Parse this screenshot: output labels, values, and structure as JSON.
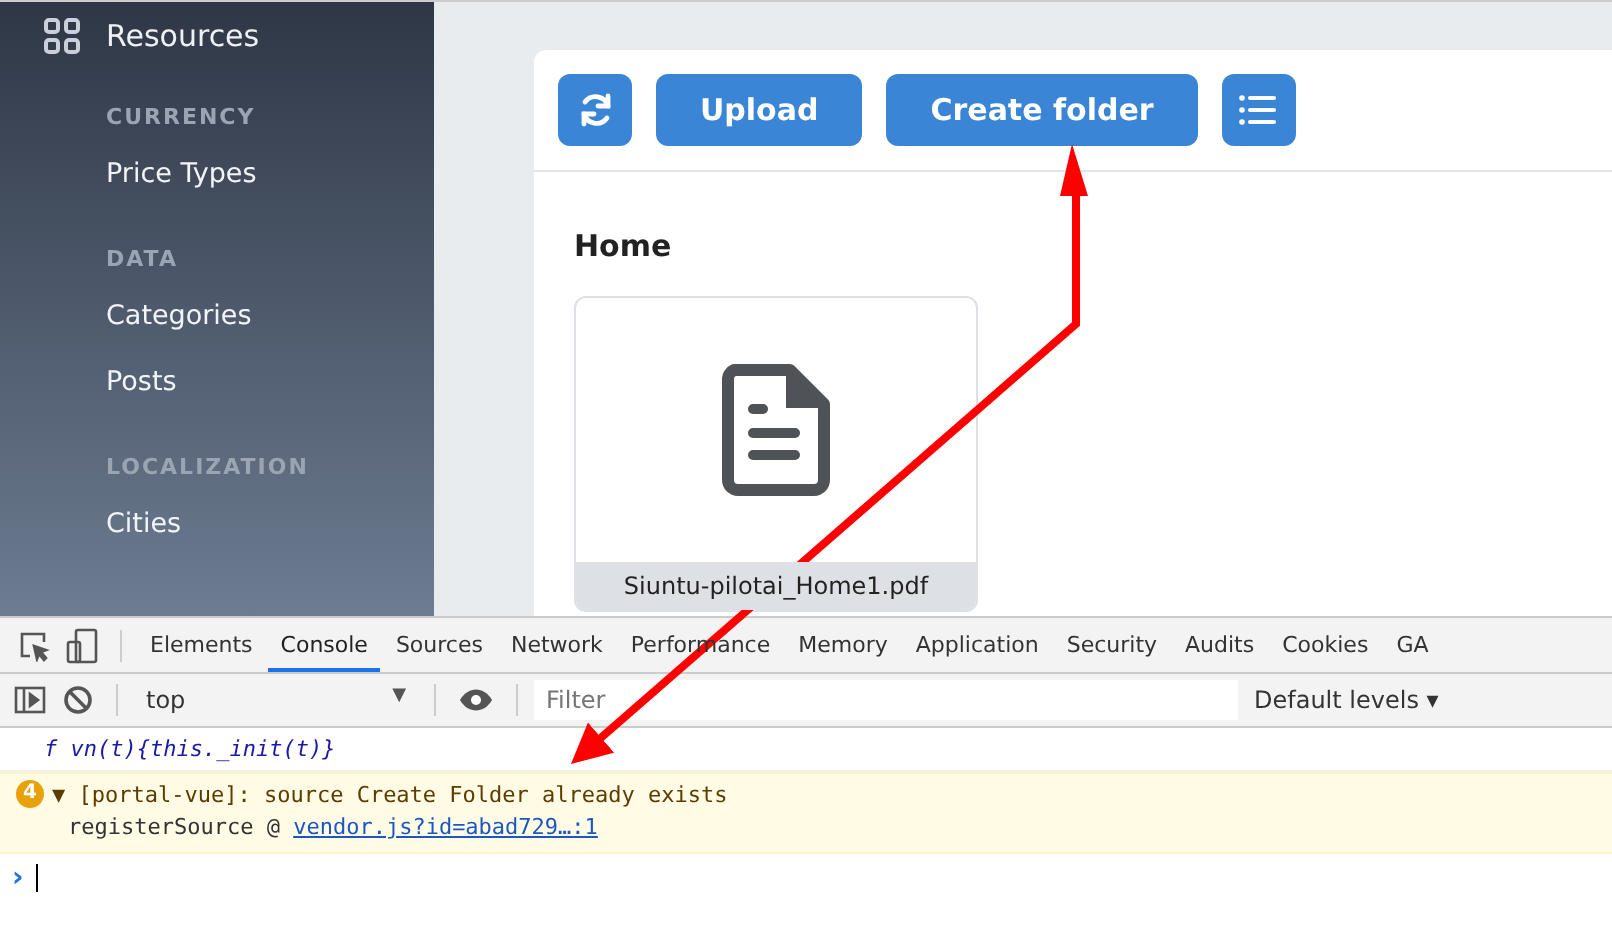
{
  "sidebar": {
    "header": {
      "label": "Resources"
    },
    "sections": [
      {
        "title": "CURRENCY",
        "items": [
          {
            "label": "Price Types"
          }
        ]
      },
      {
        "title": "DATA",
        "items": [
          {
            "label": "Categories"
          },
          {
            "label": "Posts"
          }
        ]
      },
      {
        "title": "LOCALIZATION",
        "items": [
          {
            "label": "Cities"
          }
        ]
      }
    ]
  },
  "toolbar": [
    {
      "kind": "refresh"
    },
    {
      "kind": "text",
      "label": "Upload"
    },
    {
      "kind": "text",
      "label": "Create folder"
    },
    {
      "kind": "list"
    }
  ],
  "folder": {
    "title": "Home",
    "files": [
      {
        "name": "Siuntu-pilotai_Home1.pdf"
      }
    ]
  },
  "devtools": {
    "tabs": [
      {
        "label": "Elements",
        "selected": false
      },
      {
        "label": "Console",
        "selected": true
      },
      {
        "label": "Sources",
        "selected": false
      },
      {
        "label": "Network",
        "selected": false
      },
      {
        "label": "Performance",
        "selected": false
      },
      {
        "label": "Memory",
        "selected": false
      },
      {
        "label": "Application",
        "selected": false
      },
      {
        "label": "Security",
        "selected": false
      },
      {
        "label": "Audits",
        "selected": false
      },
      {
        "label": "Cookies",
        "selected": false
      },
      {
        "label": "GA",
        "selected": false
      }
    ],
    "context": "top",
    "context_caret": "▼",
    "filter": {
      "placeholder": "Filter"
    },
    "levels": "Default levels ▾",
    "console": [
      {
        "kind": "log",
        "text": "f vn(t){this._init(t)}"
      },
      {
        "kind": "warning",
        "count": "4",
        "text": "▼ [portal-vue]: source Create Folder already exists",
        "source": "registerSource @ ",
        "link": "vendor.js?id=abad729…:1"
      }
    ],
    "prompt": "›"
  }
}
